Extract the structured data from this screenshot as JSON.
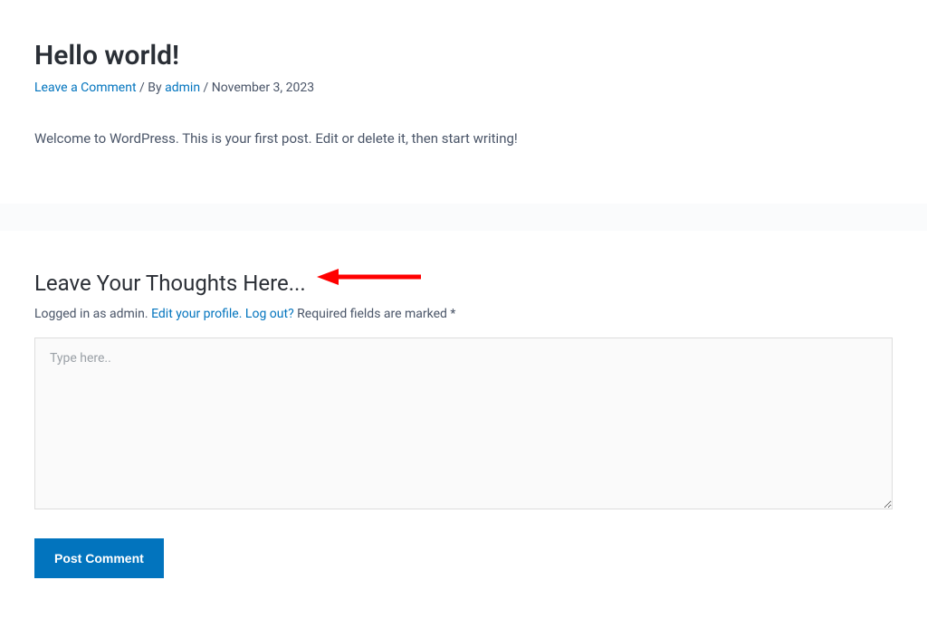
{
  "article": {
    "title": "Hello world!",
    "meta": {
      "leave_comment": "Leave a Comment",
      "by_label": "By",
      "author": "admin",
      "date": "November 3, 2023"
    },
    "body": "Welcome to WordPress. This is your first post. Edit or delete it, then start writing!"
  },
  "comments": {
    "heading": "Leave Your Thoughts Here...",
    "logged_in_prefix": "Logged in as admin.",
    "edit_profile_label": "Edit your profile",
    "logout_label": "Log out?",
    "required_note": "Required fields are marked *",
    "placeholder": "Type here..",
    "submit_label": "Post Comment"
  },
  "colors": {
    "link": "#0274be",
    "accent": "#0274be"
  }
}
